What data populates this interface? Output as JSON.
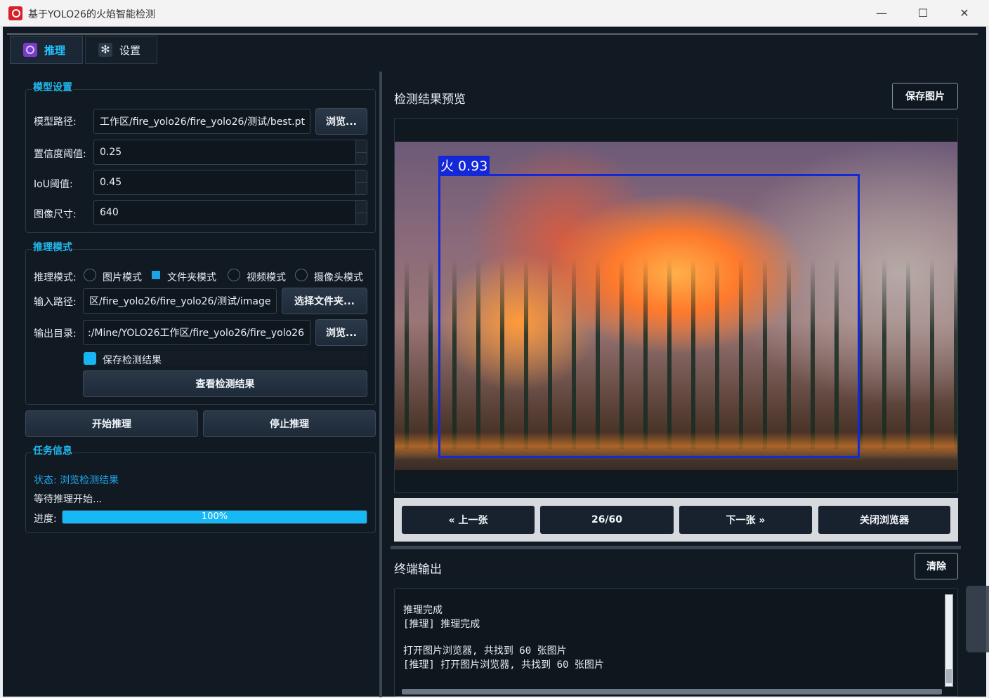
{
  "window": {
    "title": "基于YOLO26的火焰智能检测",
    "controls": {
      "minimize": "—",
      "maximize": "☐",
      "close": "✕"
    }
  },
  "tabs": [
    {
      "label": "推理",
      "icon": "target-icon",
      "active": true
    },
    {
      "label": "设置",
      "icon": "gear-icon",
      "active": false
    }
  ],
  "model_settings": {
    "title": "模型设置",
    "model_path_label": "模型路径:",
    "model_path_value": "工作区/fire_yolo26/fire_yolo26/测试/best.pt",
    "browse_label": "浏览...",
    "conf_label": "置信度阈值:",
    "conf_value": "0.25",
    "iou_label": "IoU阈值:",
    "iou_value": "0.45",
    "imgsz_label": "图像尺寸:",
    "imgsz_value": "640"
  },
  "inference_mode": {
    "title": "推理模式",
    "mode_label": "推理模式:",
    "options": [
      "图片模式",
      "文件夹模式",
      "视频模式",
      "摄像头模式"
    ],
    "selected": "文件夹模式",
    "input_label": "输入路径:",
    "input_value": "区/fire_yolo26/fire_yolo26/测试/image",
    "select_folder_label": "选择文件夹...",
    "output_label": "输出目录:",
    "output_value": ":/Mine/YOLO26工作区/fire_yolo26/fire_yolo26",
    "browse_label": "浏览...",
    "save_results_label": "保存检测结果",
    "save_results_checked": true,
    "view_results_label": "查看检测结果"
  },
  "actions": {
    "start_label": "开始推理",
    "stop_label": "停止推理"
  },
  "task_info": {
    "title": "任务信息",
    "status": "状态: 浏览检测结果",
    "message": "等待推理开始...",
    "progress_label": "进度:",
    "progress_text": "100%",
    "progress_value": 1.0
  },
  "preview": {
    "title": "检测结果预览",
    "save_label": "保存图片",
    "detection_label": "火 0.93",
    "colors": {
      "bbox": "#1428d8"
    }
  },
  "navigator": {
    "prev_label": "« 上一张",
    "counter": "26/60",
    "next_label": "下一张 »",
    "close_label": "关闭浏览器"
  },
  "terminal": {
    "title": "终端输出",
    "clear_label": "清除",
    "lines": [
      "推理完成",
      "[推理] 推理完成",
      "",
      "打开图片浏览器, 共找到 60 张图片",
      "[推理] 打开图片浏览器, 共找到 60 张图片"
    ]
  },
  "theme": {
    "accent": "#22b8f0",
    "background": "#111a22"
  }
}
